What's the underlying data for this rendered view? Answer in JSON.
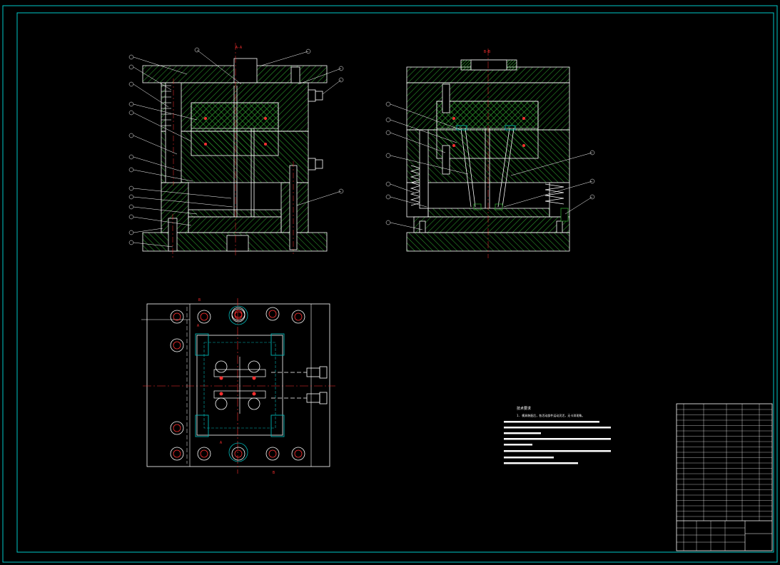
{
  "drawing": {
    "title": "CAD assembly drawing — injection mold",
    "colors": {
      "background": "#000000",
      "frame": "#00c8c8",
      "outline": "#ffffff",
      "hatch": "#2ea02e",
      "centerline": "#ff3030",
      "bolt": "#ff3030",
      "insert": "#00b4b4"
    }
  },
  "views": {
    "section_a": {
      "label": "A-A"
    },
    "section_b": {
      "label": "B-B"
    },
    "plan": {
      "marker_a": "A",
      "marker_b": "B"
    }
  },
  "notes": {
    "heading": "技术要求",
    "line1": "1. 模具装配后，各活动部件运动灵活，无卡滞现象。"
  }
}
